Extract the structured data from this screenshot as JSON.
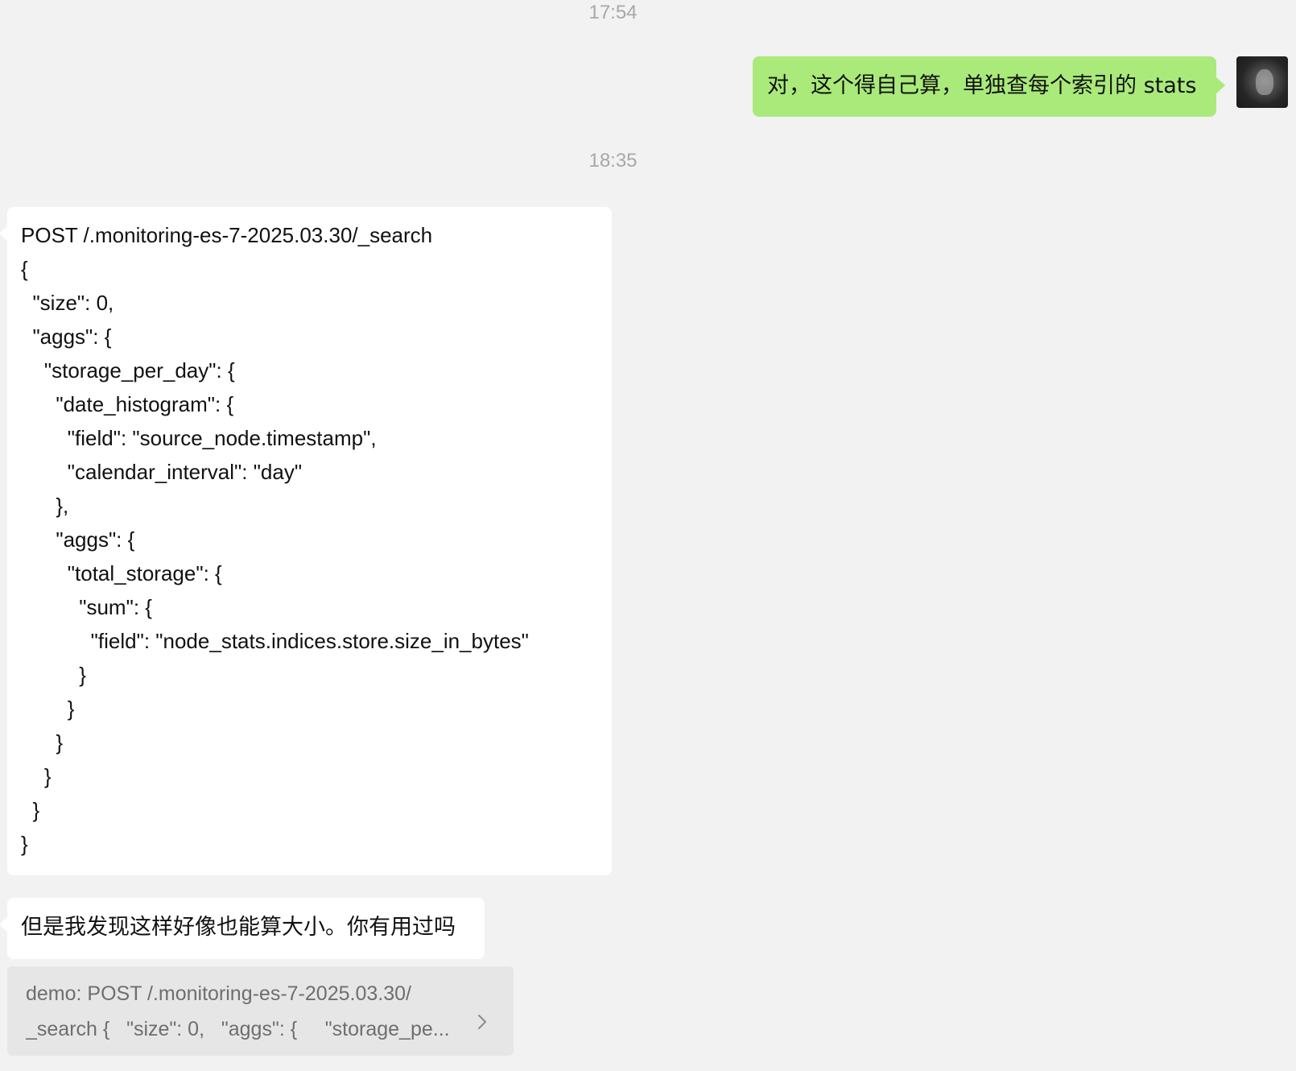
{
  "timestamps": [
    "17:54",
    "18:35"
  ],
  "messages": {
    "outgoing_1": {
      "text": "对，这个得自己算，单独查每个索引的 stats"
    },
    "incoming_code": {
      "lines": [
        "POST /.monitoring-es-7-2025.03.30/_search",
        "{",
        "  \"size\": 0,",
        "  \"aggs\": {",
        "    \"storage_per_day\": {",
        "      \"date_histogram\": {",
        "        \"field\": \"source_node.timestamp\",",
        "        \"calendar_interval\": \"day\"",
        "      },",
        "      \"aggs\": {",
        "        \"total_storage\": {",
        "          \"sum\": {",
        "            \"field\": \"node_stats.indices.store.size_in_bytes\"",
        "          }",
        "        }",
        "      }",
        "    }",
        "  }",
        "}"
      ]
    },
    "incoming_text": {
      "text": "但是我发现这样好像也能算大小。你有用过吗"
    }
  },
  "quote": {
    "line1": "demo: POST /.monitoring-es-7-2025.03.30/",
    "line2": "_search {   \"size\": 0,   \"aggs\": {     \"storage_pe..."
  },
  "icons": {
    "avatar": "user-avatar",
    "chevron": "chevron-right-icon"
  }
}
